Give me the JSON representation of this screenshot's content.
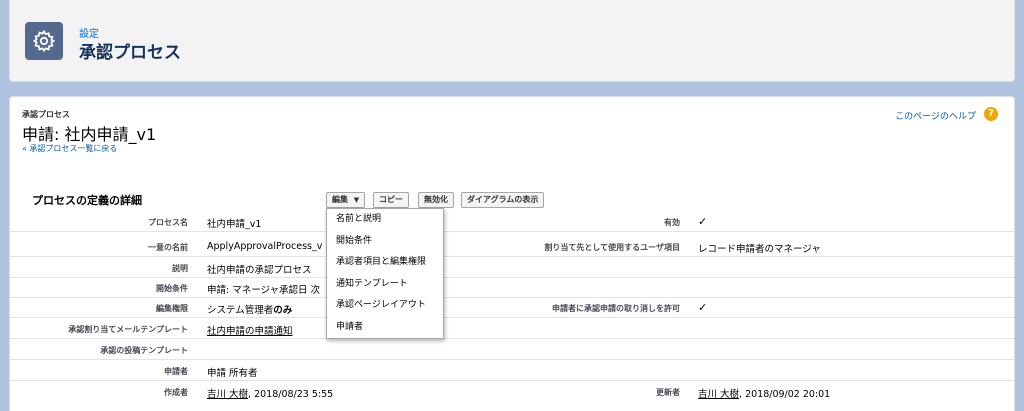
{
  "header": {
    "setup_label": "設定",
    "title": "承認プロセス",
    "icon": "gear-icon"
  },
  "record": {
    "type_label": "承認プロセス",
    "title": "申請: 社内申請_v1",
    "back_link": "« 承認プロセス一覧に戻る",
    "help_link": "このページのヘルプ",
    "help_icon": "?"
  },
  "section": {
    "title": "プロセスの定義の詳細"
  },
  "buttons": {
    "edit": "編集",
    "edit_arrow": "▼",
    "copy": "コピー",
    "deactivate": "無効化",
    "diagram": "ダイアグラムの表示"
  },
  "edit_menu": {
    "items": [
      "名前と説明",
      "開始条件",
      "承認者項目と編集権限",
      "通知テンプレート",
      "承認ページレイアウト",
      "申請者"
    ]
  },
  "details": {
    "process_name_label": "プロセス名",
    "process_name": "社内申請_v1",
    "active_label": "有効",
    "active_check": "✓",
    "unique_name_label": "一意の名前",
    "unique_name": "ApplyApprovalProcess_v",
    "assign_user_field_label": "割り当て先として使用するユーザ項目",
    "assign_user_field": "レコード申請者のマネージャ",
    "description_label": "説明",
    "description": "社内申請の承認プロセス",
    "entry_criteria_label": "開始条件",
    "entry_criteria": "申請: マネージャ承認日 次",
    "edit_permission_label": "編集権限",
    "edit_permission_prefix": "システム管理者",
    "edit_permission_suffix": "のみ",
    "allow_recall_label": "申請者に承認申請の取り消しを許可",
    "allow_recall_check": "✓",
    "assign_email_template_label": "承認割り当てメールテンプレート",
    "assign_email_template": "社内申請の申請通知",
    "post_template_label": "承認の投稿テンプレート",
    "submitter_label": "申請者",
    "submitter": "申請 所有者",
    "created_by_label": "作成者",
    "created_by_name": "吉川 大樹",
    "created_by_date": ", 2018/08/23 5:55",
    "modified_by_label": "更新者",
    "modified_by_name": "吉川 大樹",
    "modified_by_date": ", 2018/09/02 20:01"
  }
}
